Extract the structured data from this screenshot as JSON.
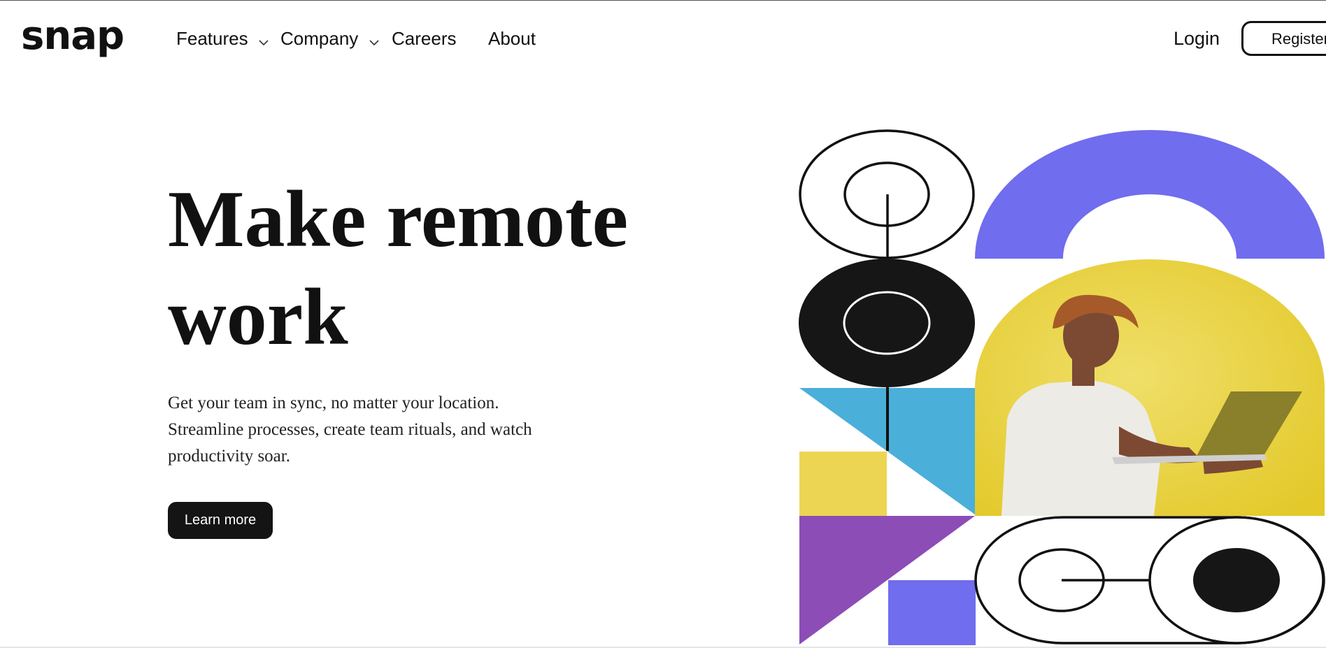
{
  "brand": {
    "logo": "snap"
  },
  "nav": {
    "items": [
      {
        "label": "Features",
        "has_dropdown": true
      },
      {
        "label": "Company",
        "has_dropdown": true
      },
      {
        "label": "Careers",
        "has_dropdown": false
      },
      {
        "label": "About",
        "has_dropdown": false
      }
    ]
  },
  "auth": {
    "login_label": "Login",
    "register_label": "Register"
  },
  "hero": {
    "headline_line1": "Make remote",
    "headline_line2": "work",
    "subtext": "Get your team in sync, no matter your location. Streamline processes, create team rituals, and watch productivity soar.",
    "cta_label": "Learn more"
  },
  "colors": {
    "accent_purple": "#706DEE",
    "accent_blue": "#4AAFD9",
    "accent_yellow": "#EDD554",
    "accent_violet": "#8C4DB6",
    "ink": "#141414"
  },
  "icons": {
    "dropdown": "chevron-down-icon"
  }
}
